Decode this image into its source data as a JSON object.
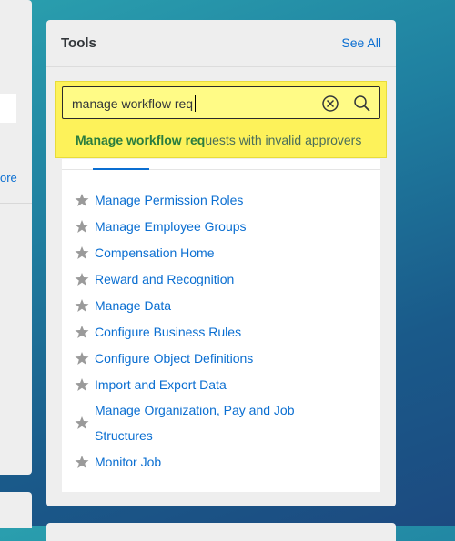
{
  "left_panel": {
    "more_link": "ore"
  },
  "tools_card": {
    "title": "Tools",
    "see_all": "See All",
    "search": {
      "value": "manage workflow req",
      "clear_icon": "clear-circle-icon",
      "search_icon": "magnifier-icon"
    },
    "suggestion": {
      "match": "Manage workflow req",
      "rest": "uests with invalid approvers"
    },
    "items": [
      {
        "label": "Manage Permission Roles"
      },
      {
        "label": "Manage Employee Groups"
      },
      {
        "label": "Compensation Home"
      },
      {
        "label": "Reward and Recognition"
      },
      {
        "label": "Manage Data"
      },
      {
        "label": "Configure Business Rules"
      },
      {
        "label": "Configure Object Definitions"
      },
      {
        "label": "Import and Export Data"
      },
      {
        "label": "Manage Organization, Pay and Job Structures"
      },
      {
        "label": "Monitor Job"
      }
    ]
  },
  "colors": {
    "link": "#0a6ed1",
    "highlight": "#fdf25a",
    "match": "#2a7d3e",
    "star": "#9a9a9a"
  }
}
